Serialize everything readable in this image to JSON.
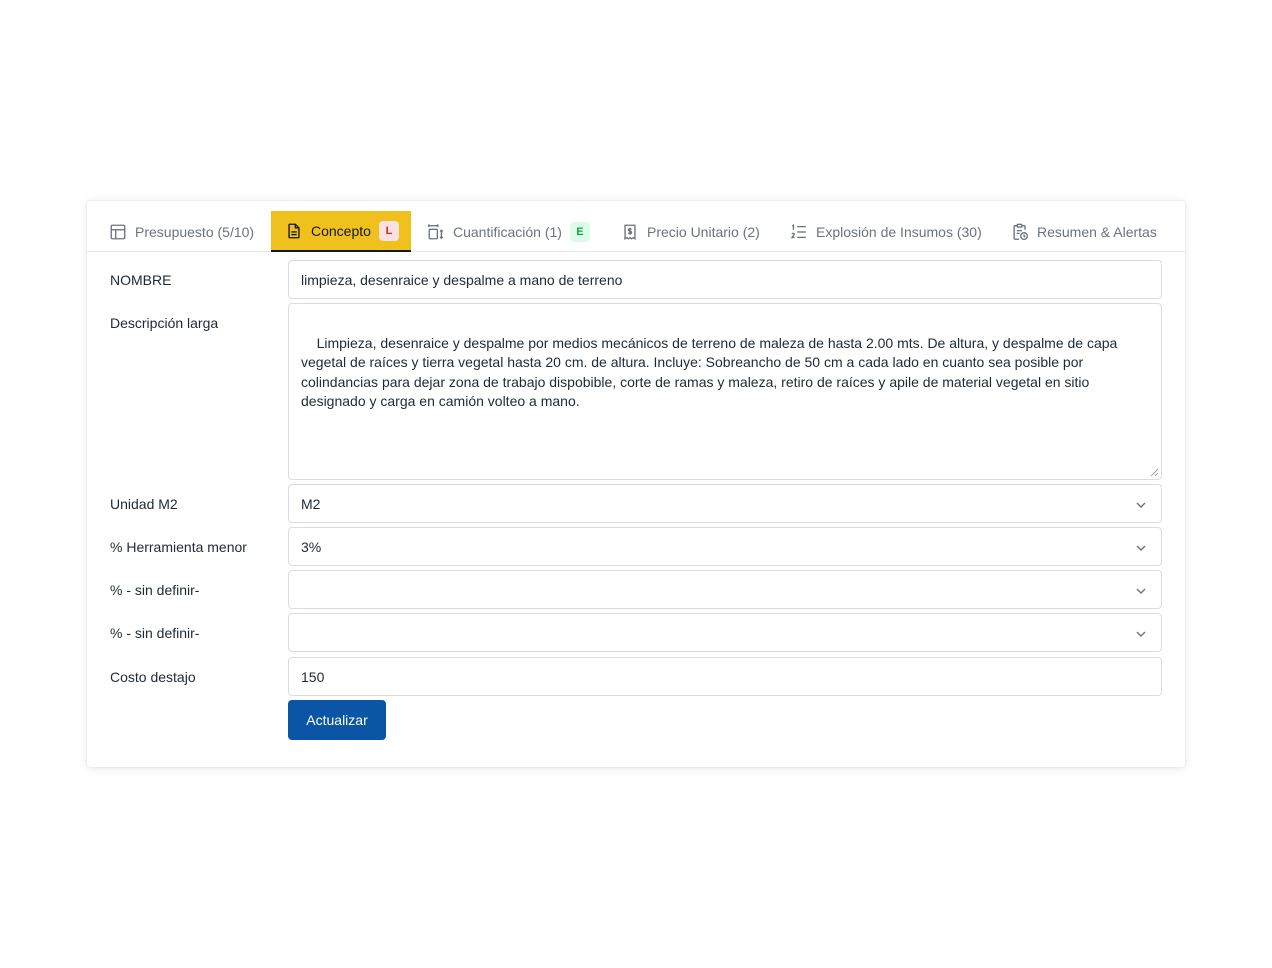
{
  "tabs": [
    {
      "label": "Presupuesto (5/10)",
      "icon": "table-icon"
    },
    {
      "label": "Concepto",
      "icon": "document-icon",
      "badge": "L",
      "active": true
    },
    {
      "label": "Cuantificación (1)",
      "icon": "quantify-icon",
      "badge": "E"
    },
    {
      "label": "Precio Unitario (2)",
      "icon": "receipt-dollar-icon"
    },
    {
      "label": "Explosión de Insumos (30)",
      "icon": "numbered-list-icon"
    },
    {
      "label": "Resumen & Alertas",
      "icon": "clipboard-clock-icon"
    }
  ],
  "form": {
    "nombre_label": "NOMBRE",
    "nombre_value": "limpieza, desenraice y despalme a mano de terreno",
    "descripcion_label": "Descripción larga",
    "descripcion_value": "Limpieza, desenraice y despalme por medios mecánicos de terreno de maleza de hasta 2.00 mts. De altura, y despalme de capa vegetal de raíces y tierra vegetal hasta 20 cm. de altura. Incluye: Sobreancho de 50 cm a cada lado en cuanto sea posible por colindancias para dejar zona de trabajo dispobible, corte de ramas y maleza, retiro de raíces y apile de material vegetal en sitio designado y carga en camión volteo a mano.",
    "unidad_label": "Unidad M2",
    "unidad_value": "M2",
    "herramienta_label": "% Herramienta menor",
    "herramienta_value": "3%",
    "pct1_label": "% - sin definir-",
    "pct1_value": "",
    "pct2_label": "% - sin definir-",
    "pct2_value": "",
    "costo_label": "Costo destajo",
    "costo_value": "150",
    "submit_label": "Actualizar"
  },
  "colors": {
    "active_tab": "#f0c01c",
    "primary_button": "#0b55a6",
    "badge_red": "#dc2626",
    "badge_green": "#16a34a"
  }
}
